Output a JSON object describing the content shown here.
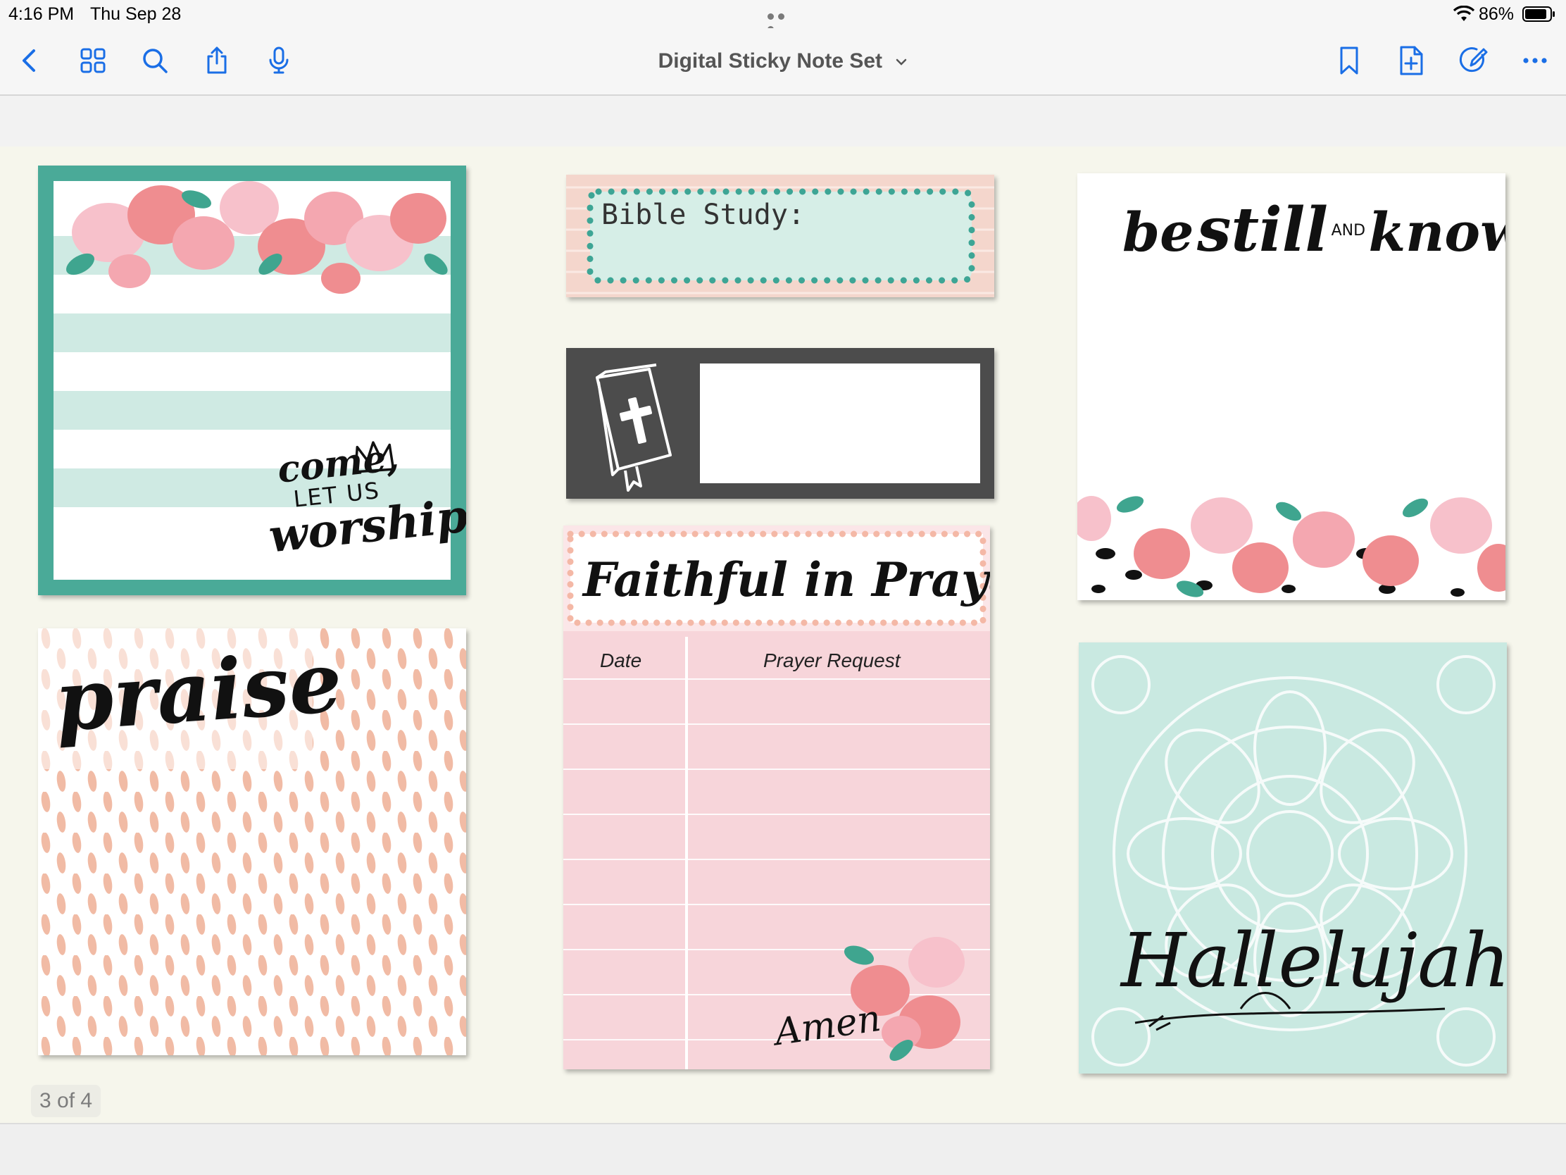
{
  "status_bar": {
    "time": "4:16 PM",
    "date": "Thu Sep 28",
    "battery": "86%"
  },
  "toolbar": {
    "title": "Digital Sticky Note Set",
    "left_icons": [
      "back-chevron-icon",
      "grid-icon",
      "search-icon",
      "share-icon",
      "microphone-icon"
    ],
    "right_icons": [
      "bookmark-icon",
      "add-page-icon",
      "markup-pen-icon",
      "more-icon"
    ],
    "accent_color": "#1a6ee6"
  },
  "notes": {
    "worship": {
      "line1": "come,",
      "line2": "LET US",
      "line3": "worship"
    },
    "bible_study": {
      "label": "Bible Study:"
    },
    "faithful": {
      "title": "Faithful in Prayer",
      "col_date": "Date",
      "col_request": "Prayer Request",
      "signature": "Amen"
    },
    "be_still": {
      "word1": "be",
      "word2": "still",
      "word3": "AND",
      "word4": "know"
    },
    "praise": {
      "word": "praise"
    },
    "hallelujah": {
      "word": "Hallelujah"
    }
  },
  "page_indicator": "3 of 4",
  "colors": {
    "teal": "#4aaa98",
    "mint": "#d4ece6",
    "peach": "#f4d6cc",
    "pink": "#f7d3d8",
    "chalk": "#4a4a4a",
    "rose": "#ef8d90"
  }
}
